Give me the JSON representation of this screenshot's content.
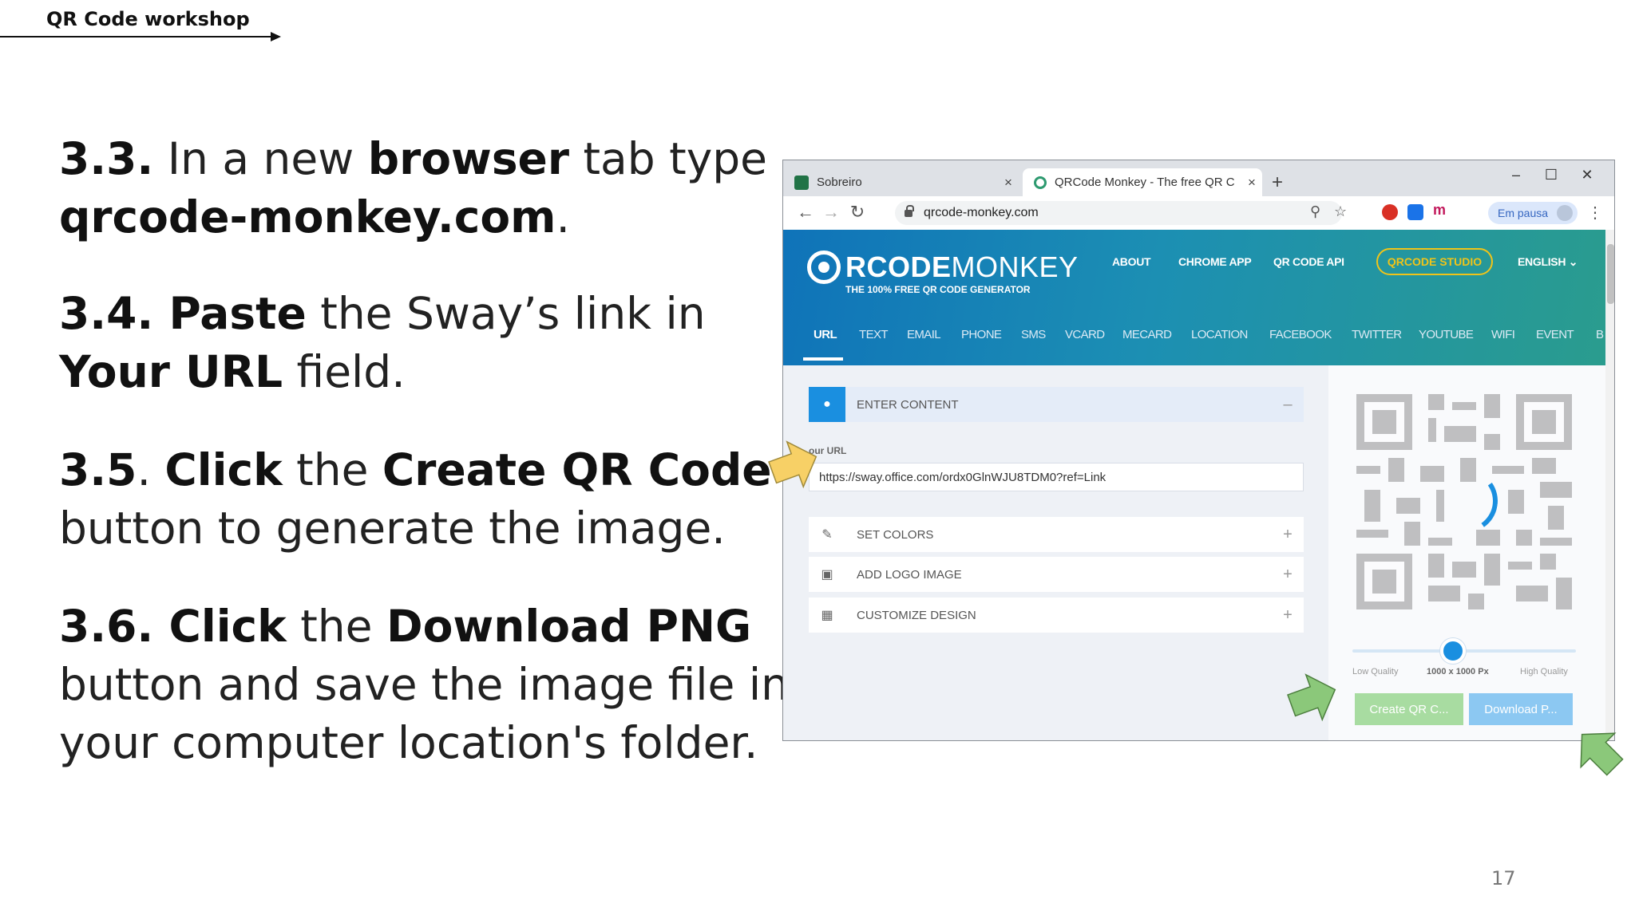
{
  "header": {
    "title": "QR Code workshop"
  },
  "steps": [
    {
      "num": "3.3.",
      "t1": " In a new ",
      "b1": "browser",
      "t2": " tab type",
      "b2": "qrcode-monkey.com",
      "t3": "."
    },
    {
      "num": "3.4.",
      "b1": " Paste",
      "t1": " the Sway’s link in",
      "b2": "Your URL",
      "t2": " field."
    },
    {
      "num": "3.5",
      "t1": ". ",
      "b1": "Click",
      "t2": " the ",
      "b2": "Create QR Code",
      "line2": "button to generate the image."
    },
    {
      "num": "3.6.",
      "b1": " Click",
      "t1": " the ",
      "b2": "Download PNG",
      "line2": "button and save the image file in",
      "line3": "your computer location's folder."
    }
  ],
  "page_number": "17",
  "browser": {
    "tabs": [
      {
        "label": "Sobreiro",
        "close": "×"
      },
      {
        "label": "QRCode Monkey - The free QR C",
        "close": "×"
      }
    ],
    "new_tab": "+",
    "window_controls": {
      "minimize": "–",
      "maximize": "☐",
      "close": "✕"
    },
    "nav": {
      "back": "←",
      "forward": "→",
      "reload": "↻"
    },
    "address": "qrcode-monkey.com",
    "icons": {
      "zoom": "⚲",
      "star": "☆",
      "menu": "⋮"
    },
    "extension_m": "m",
    "profile_status": "Em pausa"
  },
  "site": {
    "brand_bold": "RCODE",
    "brand_light": "MONKEY",
    "tagline": "THE 100% FREE QR CODE GENERATOR",
    "top_nav": [
      "ABOUT",
      "CHROME APP",
      "QR CODE API"
    ],
    "studio_button": "QRCODE STUDIO",
    "language": "ENGLISH ⌄",
    "type_tabs": [
      "URL",
      "TEXT",
      "EMAIL",
      "PHONE",
      "SMS",
      "VCARD",
      "MECARD",
      "LOCATION",
      "FACEBOOK",
      "TWITTER",
      "YOUTUBE",
      "WIFI",
      "EVENT",
      "B"
    ],
    "enter_content": "ENTER CONTENT",
    "collapse": "–",
    "url_label": "our URL",
    "url_value": "https://sway.office.com/ordx0GlnWJU8TDM0?ref=Link",
    "sections": [
      "SET COLORS",
      "ADD LOGO IMAGE",
      "CUSTOMIZE DESIGN"
    ],
    "expand": "+",
    "section_icons": {
      "enter": "●",
      "colors": "✎",
      "logo": "▣",
      "design": "▦"
    },
    "quality_low": "Low Quality",
    "quality_value": "1000 x 1000 Px",
    "quality_high": "High Quality",
    "quality_level": 0.45,
    "create_button": "Create QR C...",
    "download_button": "Download P..."
  },
  "colors": {
    "accent_blue": "#1a8fe0",
    "studio_yellow": "#f0c419",
    "create_green": "#a8dca1",
    "download_blue": "#8cc8f2",
    "pointer_yellow": "#f7d066",
    "pointer_green": "#8bc87a"
  }
}
